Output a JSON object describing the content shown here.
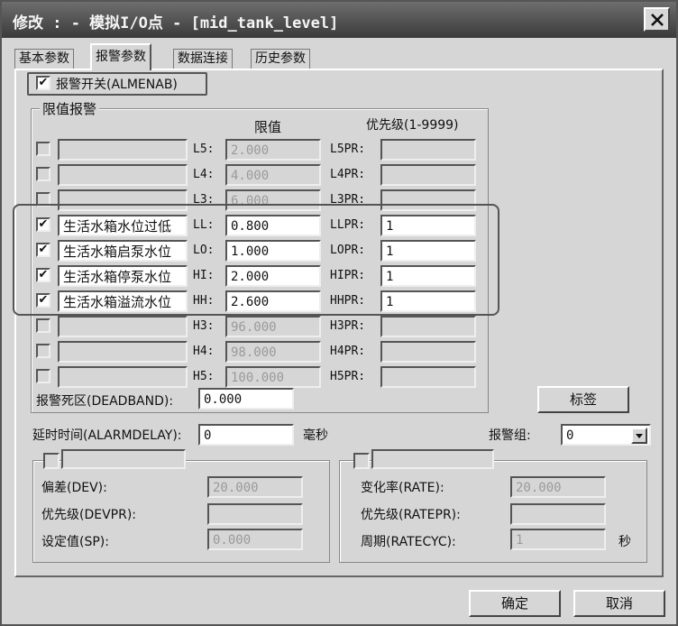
{
  "window": {
    "title": "修改 : - 模拟I/O点 - [mid_tank_level]"
  },
  "tabs": [
    {
      "label": "基本参数"
    },
    {
      "label": "报警参数"
    },
    {
      "label": "数据连接"
    },
    {
      "label": "历史参数"
    }
  ],
  "alarm_switch": {
    "label": "报警开关(ALMENAB)",
    "checked": "✔"
  },
  "limits_group": {
    "title": "限值报警",
    "col_limit": "限值",
    "col_priority": "优先级(1-9999)",
    "rows": [
      {
        "checked": "",
        "desc": "",
        "code": "L5:",
        "value": "2.000",
        "prio_code": "L5PR:",
        "priority": "",
        "enabled": false
      },
      {
        "checked": "",
        "desc": "",
        "code": "L4:",
        "value": "4.000",
        "prio_code": "L4PR:",
        "priority": "",
        "enabled": false
      },
      {
        "checked": "",
        "desc": "",
        "code": "L3:",
        "value": "6.000",
        "prio_code": "L3PR:",
        "priority": "",
        "enabled": false
      },
      {
        "checked": "✔",
        "desc": "生活水箱水位过低",
        "code": "LL:",
        "value": "0.800",
        "prio_code": "LLPR:",
        "priority": "1",
        "enabled": true
      },
      {
        "checked": "✔",
        "desc": "生活水箱启泵水位",
        "code": "LO:",
        "value": "1.000",
        "prio_code": "LOPR:",
        "priority": "1",
        "enabled": true
      },
      {
        "checked": "✔",
        "desc": "生活水箱停泵水位",
        "code": "HI:",
        "value": "2.000",
        "prio_code": "HIPR:",
        "priority": "1",
        "enabled": true
      },
      {
        "checked": "✔",
        "desc": "生活水箱溢流水位",
        "code": "HH:",
        "value": "2.600",
        "prio_code": "HHPR:",
        "priority": "1",
        "enabled": true
      },
      {
        "checked": "",
        "desc": "",
        "code": "H3:",
        "value": "96.000",
        "prio_code": "H3PR:",
        "priority": "",
        "enabled": false
      },
      {
        "checked": "",
        "desc": "",
        "code": "H4:",
        "value": "98.000",
        "prio_code": "H4PR:",
        "priority": "",
        "enabled": false
      },
      {
        "checked": "",
        "desc": "",
        "code": "H5:",
        "value": "100.000",
        "prio_code": "H5PR:",
        "priority": "",
        "enabled": false
      }
    ],
    "deadband_label": "报警死区(DEADBAND):",
    "deadband_value": "0.000"
  },
  "tag_button": "标签",
  "alarm_delay": {
    "label": "延时时间(ALARMDELAY):",
    "value": "0",
    "unit": "毫秒"
  },
  "alarm_group": {
    "label": "报警组:",
    "value": "0"
  },
  "deviation": {
    "dev_label": "偏差(DEV):",
    "dev_value": "20.000",
    "devpr_label": "优先级(DEVPR):",
    "devpr_value": "",
    "sp_label": "设定值(SP):",
    "sp_value": "0.000"
  },
  "rate": {
    "rate_label": "变化率(RATE):",
    "rate_value": "20.000",
    "ratepr_label": "优先级(RATEPR):",
    "ratepr_value": "",
    "ratecyc_label": "周期(RATECYC):",
    "ratecyc_value": "1",
    "unit": "秒"
  },
  "buttons": {
    "ok": "确定",
    "cancel": "取消"
  },
  "colors": {
    "titlebar": "#4a4a4a",
    "dialog": "#d6d6d6",
    "disabled_text": "#9a9a9a"
  }
}
